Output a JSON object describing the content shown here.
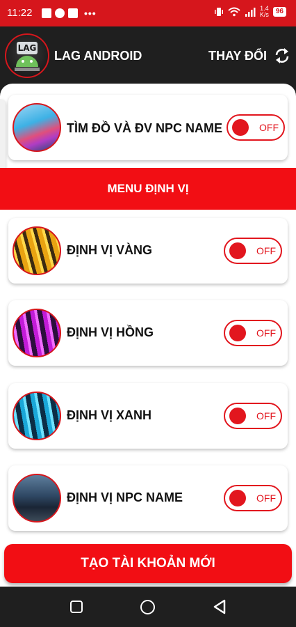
{
  "status_bar": {
    "time": "11:22",
    "net_speed_value": "1.4",
    "net_speed_unit": "K/s",
    "battery": "96"
  },
  "header": {
    "app_title": "LAG ANDROID",
    "logo_text": "LAG",
    "change_label": "THAY ĐỔI"
  },
  "top_card": {
    "label": "TÌM ĐỒ VÀ ĐV NPC NAME",
    "toggle": "OFF"
  },
  "section": {
    "title": "MENU ĐỊNH VỊ"
  },
  "cards": [
    {
      "label": "ĐỊNH VỊ VÀNG",
      "toggle": "OFF"
    },
    {
      "label": "ĐỊNH VỊ HỒNG",
      "toggle": "OFF"
    },
    {
      "label": "ĐỊNH VỊ XANH",
      "toggle": "OFF"
    },
    {
      "label": "ĐỊNH VỊ NPC NAME",
      "toggle": "OFF"
    }
  ],
  "footer": {
    "create_account_label": "TẠO TÀI KHOẢN MỚI"
  },
  "colors": {
    "accent": "#f20e14",
    "header_bg": "#1f1f1f"
  }
}
